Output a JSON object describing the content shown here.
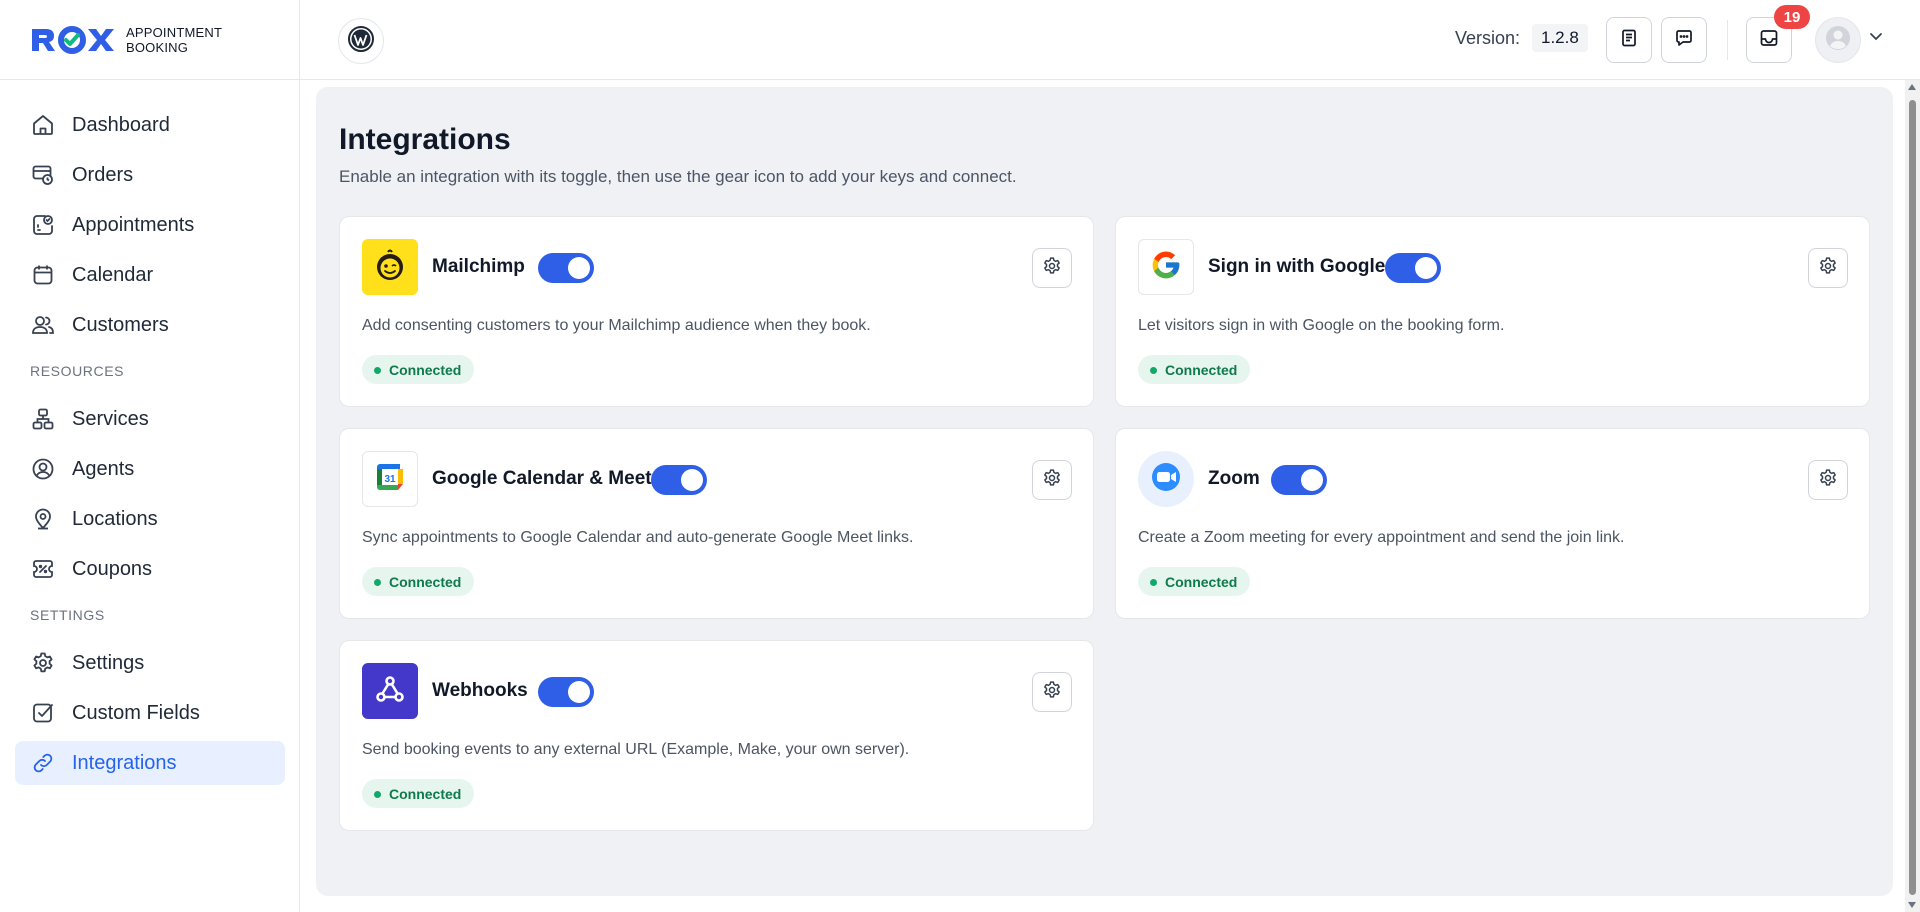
{
  "brand": {
    "name_line1": "APPOINTMENT",
    "name_line2": "BOOKING",
    "accent": "#2f5fe6"
  },
  "sidebar": {
    "items": [
      {
        "label": "Dashboard",
        "icon": "home-icon"
      },
      {
        "label": "Orders",
        "icon": "orders-icon"
      },
      {
        "label": "Appointments",
        "icon": "appointments-icon"
      },
      {
        "label": "Calendar",
        "icon": "calendar-icon"
      },
      {
        "label": "Customers",
        "icon": "users-icon"
      }
    ],
    "resources_heading": "RESOURCES",
    "resources": [
      {
        "label": "Services",
        "icon": "services-icon"
      },
      {
        "label": "Agents",
        "icon": "agent-icon"
      },
      {
        "label": "Locations",
        "icon": "location-pin-icon"
      },
      {
        "label": "Coupons",
        "icon": "coupon-icon"
      }
    ],
    "settings_heading": "SETTINGS",
    "settings": [
      {
        "label": "Settings",
        "icon": "gear-icon"
      },
      {
        "label": "Custom Fields",
        "icon": "checkbox-icon"
      },
      {
        "label": "Integrations",
        "icon": "link-icon",
        "active": true
      }
    ]
  },
  "topbar": {
    "version_label": "Version:",
    "version_value": "1.2.8",
    "notification_count": "19"
  },
  "page": {
    "title": "Integrations",
    "description": "Enable an integration with its toggle, then use the gear icon to add your keys and connect."
  },
  "integrations": [
    {
      "name": "Mailchimp",
      "description": "Add consenting customers to your Mailchimp audience when they book.",
      "status": "Connected",
      "enabled": true
    },
    {
      "name": "Sign in with Google",
      "description": "Let visitors sign in with Google on the booking form.",
      "status": "Connected",
      "enabled": true
    },
    {
      "name": "Google Calendar & Meet",
      "description": "Sync appointments to Google Calendar and auto-generate Google Meet links.",
      "status": "Connected",
      "enabled": true
    },
    {
      "name": "Zoom",
      "description": "Create a Zoom meeting for every appointment and send the join link.",
      "status": "Connected",
      "enabled": true
    },
    {
      "name": "Webhooks",
      "description": "Send booking events to any external URL (Example, Make, your own server).",
      "status": "Connected",
      "enabled": true
    }
  ]
}
